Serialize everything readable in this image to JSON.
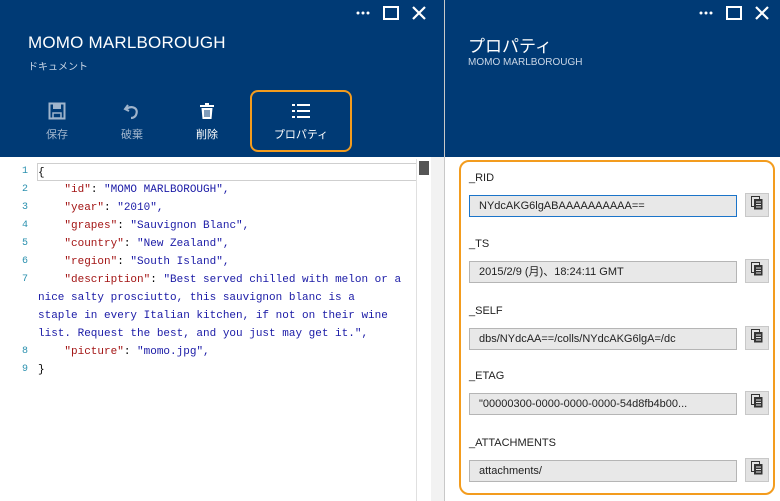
{
  "left_blade": {
    "title": "MOMO MARLBOROUGH",
    "subtitle": "ドキュメント",
    "toolbar": {
      "save_label": "保存",
      "discard_label": "破棄",
      "delete_label": "削除",
      "properties_label": "プロパティ"
    },
    "window_controls": [
      "more-icon",
      "maximize-icon",
      "close-icon"
    ]
  },
  "editor": {
    "line_numbers": [
      "1",
      "2",
      "3",
      "4",
      "5",
      "6",
      "7",
      "",
      "",
      "",
      "8",
      "9"
    ],
    "lines": [
      {
        "num": "1",
        "text": "{"
      },
      {
        "num": "2",
        "key": "\"id\"",
        "value": "\"MOMO MARLBOROUGH\","
      },
      {
        "num": "3",
        "key": "\"year\"",
        "value": "\"2010\","
      },
      {
        "num": "4",
        "key": "\"grapes\"",
        "value": "\"Sauvignon Blanc\","
      },
      {
        "num": "5",
        "key": "\"country\"",
        "value": "\"New Zealand\","
      },
      {
        "num": "6",
        "key": "\"region\"",
        "value": "\"South Island\","
      },
      {
        "num": "7",
        "key": "\"description\"",
        "value": "\"Best served chilled with melon or a"
      },
      {
        "num": "",
        "text": "nice salty prosciutto, this sauvignon blanc is a"
      },
      {
        "num": "",
        "text": "staple in every Italian kitchen, if not on their wine"
      },
      {
        "num": "",
        "text": "list. Request the best, and you just may get it.\","
      },
      {
        "num": "8",
        "key": "\"picture\"",
        "value": "\"momo.jpg\","
      },
      {
        "num": "9",
        "text": "}"
      }
    ]
  },
  "right_blade": {
    "title": "プロパティ",
    "subtitle": "MOMO MARLBOROUGH",
    "properties": [
      {
        "label": "_RID",
        "value": "NYdcAKG6lgABAAAAAAAAAA=="
      },
      {
        "label": "_TS",
        "value": "2015/2/9 (月)、18:24:11 GMT"
      },
      {
        "label": "_SELF",
        "value": "dbs/NYdcAA==/colls/NYdcAKG6lgA=/dc"
      },
      {
        "label": "_ETAG",
        "value": "\"00000300-0000-0000-0000-54d8fb4b00..."
      },
      {
        "label": "_ATTACHMENTS",
        "value": "attachments/"
      }
    ]
  },
  "colors": {
    "header_bg": "#003a75",
    "highlight": "#f39c1e",
    "json_key": "#a31515",
    "json_string": "#1a1aa6",
    "line_number": "#2b91af"
  }
}
